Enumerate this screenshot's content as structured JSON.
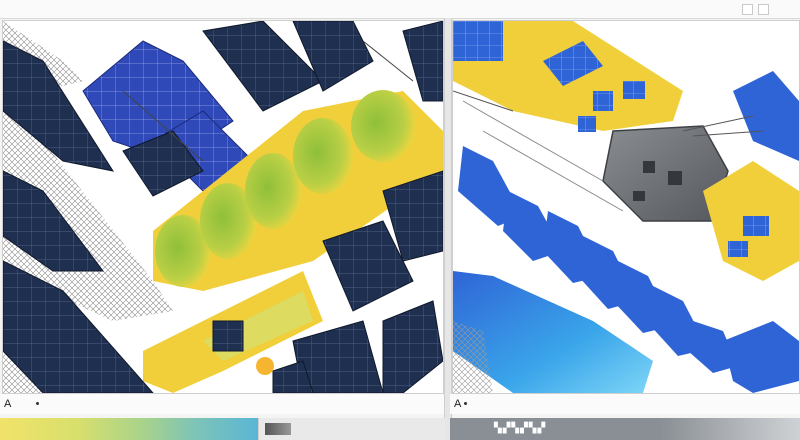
{
  "window": {
    "title": ""
  },
  "left_pane": {
    "name": "left-illustration",
    "status_glyph": "A"
  },
  "right_pane": {
    "name": "right-illustration",
    "status_glyph": "A"
  },
  "icons": {
    "minimize": "minimize-icon",
    "maximize": "maximize-icon"
  },
  "colors": {
    "panel_navy": "#1f2f4f",
    "panel_blue": "#2f49b8",
    "bright_blue": "#2f64d6",
    "yellow": "#f1cf3a",
    "lime": "#a7c93a",
    "gray_device": "#6b6e73"
  }
}
